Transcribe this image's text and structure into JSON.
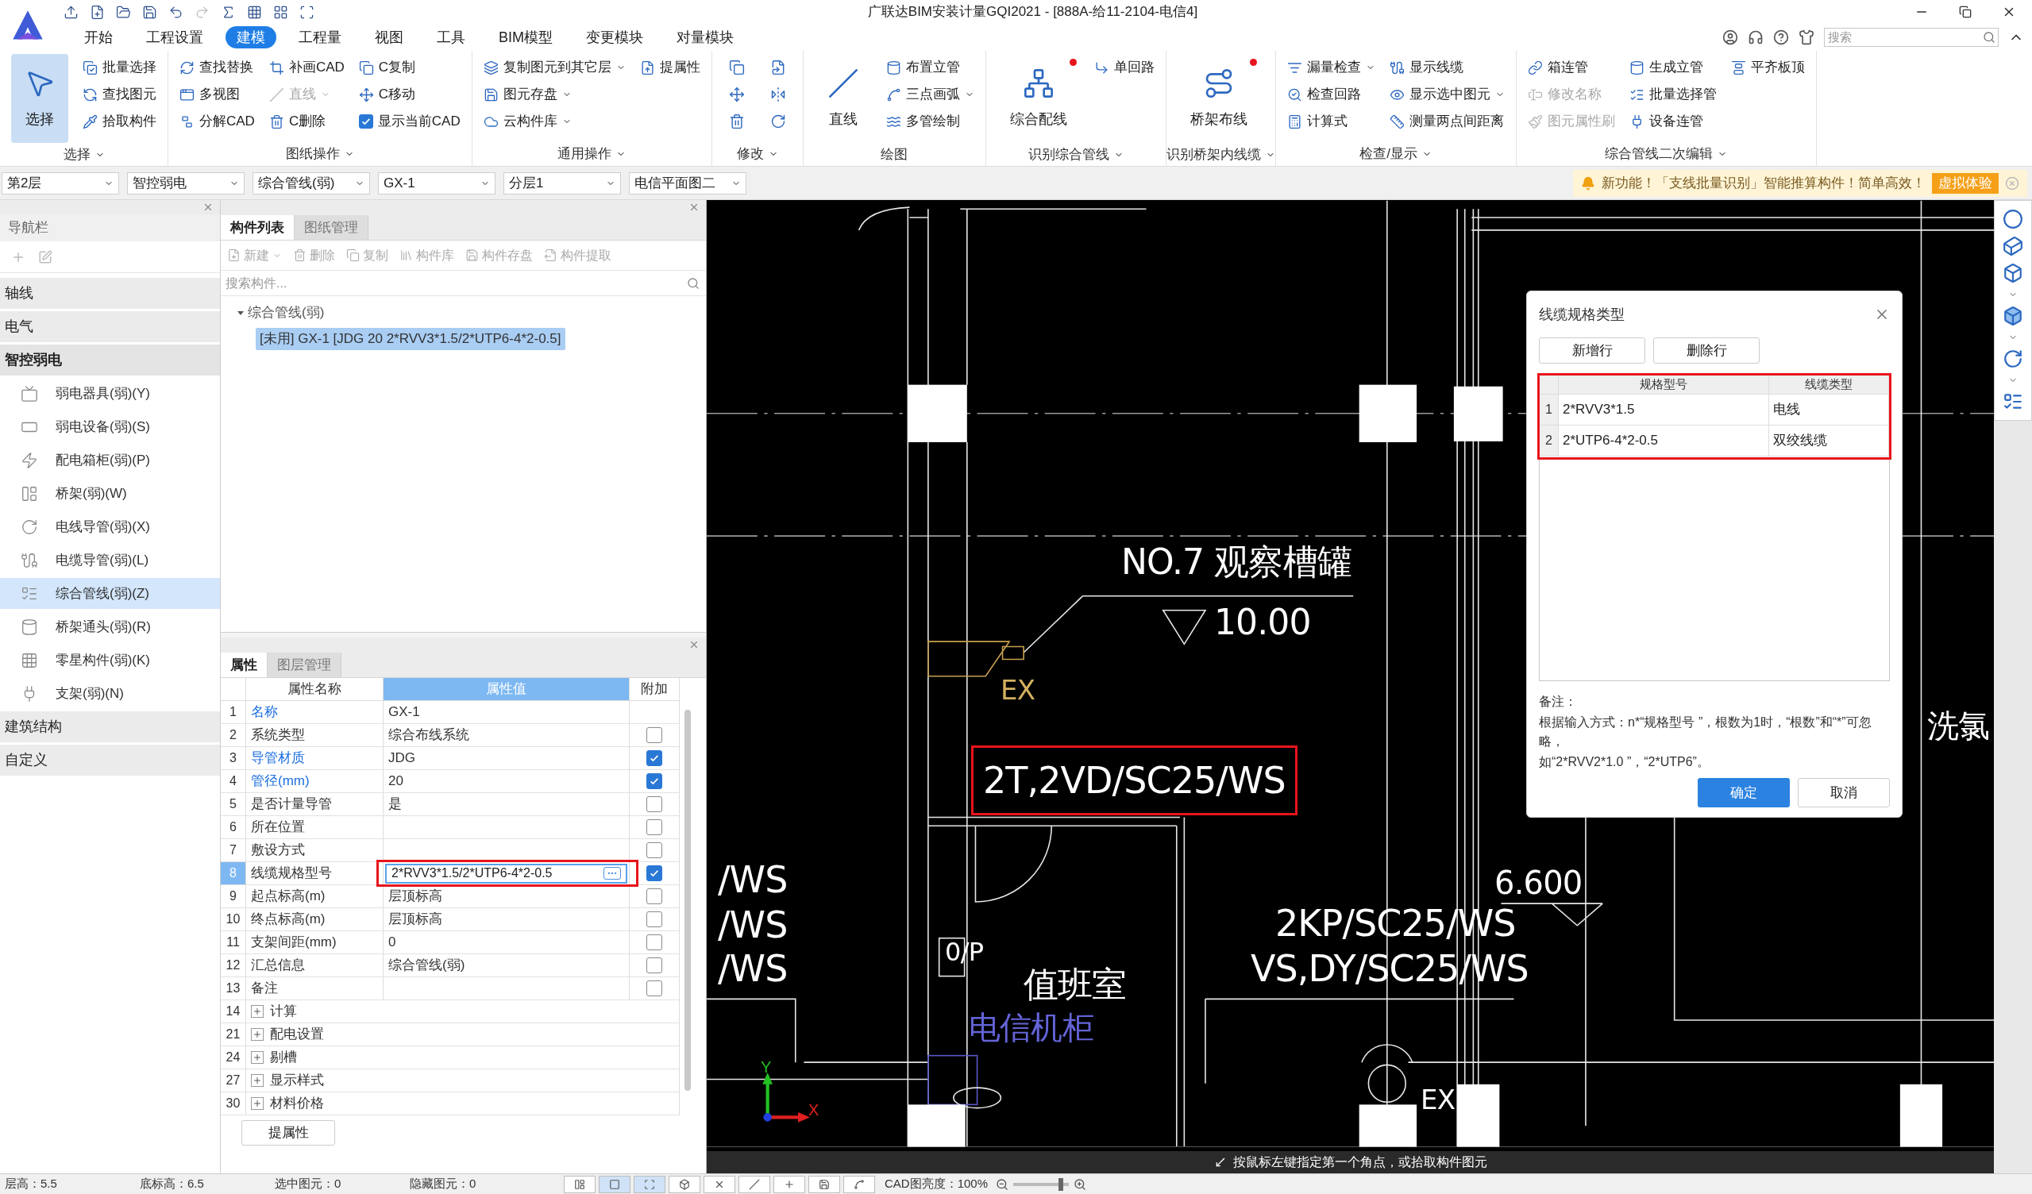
{
  "app": {
    "title": "广联达BIM安装计量GQI2021 - [888A-给11-2104-电信4]",
    "search": {
      "placeholder": "搜索"
    }
  },
  "menu": [
    {
      "label": "开始",
      "selected": false
    },
    {
      "label": "工程设置",
      "selected": false
    },
    {
      "label": "建模",
      "selected": true
    },
    {
      "label": "工程量",
      "selected": false
    },
    {
      "label": "视图",
      "selected": false
    },
    {
      "label": "工具",
      "selected": false
    },
    {
      "label": "BIM模型",
      "selected": false
    },
    {
      "label": "变更模块",
      "selected": false
    },
    {
      "label": "对量模块",
      "selected": false
    }
  ],
  "ribbon": [
    {
      "label": "选择",
      "dropdown": true,
      "columns": [
        [
          {
            "kind": "big",
            "label": "选择",
            "active": true,
            "badge": false
          }
        ],
        [
          {
            "kind": "small",
            "label": "批量选择",
            "disabled": false
          },
          {
            "kind": "small",
            "label": "查找图元",
            "disabled": false
          },
          {
            "kind": "small",
            "label": "拾取构件",
            "disabled": false
          }
        ]
      ]
    },
    {
      "label": "图纸操作",
      "dropdown": true,
      "columns": [
        [
          {
            "kind": "small",
            "label": "查找替换",
            "disabled": false
          },
          {
            "kind": "small",
            "label": "多视图",
            "disabled": false
          },
          {
            "kind": "small",
            "label": "分解CAD",
            "disabled": false
          }
        ],
        [
          {
            "kind": "small",
            "label": "补画CAD",
            "disabled": false
          },
          {
            "kind": "small",
            "label": "直线",
            "disabled": true,
            "dropdown": true
          },
          {
            "kind": "small",
            "label": "C删除",
            "disabled": false
          }
        ],
        [
          {
            "kind": "small",
            "label": "C复制",
            "disabled": false
          },
          {
            "kind": "small",
            "label": "C移动",
            "disabled": false
          },
          {
            "kind": "check",
            "label": "显示当前CAD",
            "checked": true
          }
        ]
      ]
    },
    {
      "label": "通用操作",
      "dropdown": true,
      "columns": [
        [
          {
            "kind": "small",
            "label": "复制图元到其它层",
            "disabled": false,
            "dropdown": true
          },
          {
            "kind": "small",
            "label": "图元存盘",
            "disabled": false,
            "dropdown": true
          },
          {
            "kind": "small",
            "label": "云构件库",
            "disabled": false,
            "dropdown": true
          }
        ],
        [
          {
            "kind": "small",
            "label": "提属性",
            "disabled": false
          }
        ]
      ]
    },
    {
      "label": "修改",
      "dropdown": true,
      "columns": [
        [
          {
            "kind": "icon",
            "disabled": false
          },
          {
            "kind": "icon",
            "disabled": false
          },
          {
            "kind": "icon",
            "disabled": false
          }
        ],
        [
          {
            "kind": "icon",
            "disabled": false
          },
          {
            "kind": "icon",
            "disabled": false
          },
          {
            "kind": "icon",
            "disabled": false
          }
        ]
      ]
    },
    {
      "label": "绘图",
      "dropdown": false,
      "columns": [
        [
          {
            "kind": "big",
            "label": "直线",
            "active": false,
            "badge": false
          }
        ],
        [
          {
            "kind": "small",
            "label": "布置立管",
            "disabled": false
          },
          {
            "kind": "small",
            "label": "三点画弧",
            "disabled": false,
            "dropdown": true
          },
          {
            "kind": "small",
            "label": "多管绘制",
            "disabled": false
          }
        ]
      ]
    },
    {
      "label": "识别综合管线",
      "dropdown": true,
      "columns": [
        [
          {
            "kind": "big",
            "label": "综合配线",
            "active": false,
            "badge": true
          }
        ],
        [
          {
            "kind": "small",
            "label": "单回路",
            "disabled": false
          }
        ]
      ]
    },
    {
      "label": "识别桥架内线缆",
      "dropdown": true,
      "columns": [
        [
          {
            "kind": "big",
            "label": "桥架布线",
            "active": false,
            "badge": true
          }
        ]
      ]
    },
    {
      "label": "检查/显示",
      "dropdown": true,
      "columns": [
        [
          {
            "kind": "small",
            "label": "漏量检查",
            "disabled": false,
            "dropdown": true
          },
          {
            "kind": "small",
            "label": "检查回路",
            "disabled": false
          },
          {
            "kind": "small",
            "label": "计算式",
            "disabled": false
          }
        ],
        [
          {
            "kind": "small",
            "label": "显示线缆",
            "disabled": false
          },
          {
            "kind": "small",
            "label": "显示选中图元",
            "disabled": false,
            "dropdown": true
          },
          {
            "kind": "small",
            "label": "测量两点间距离",
            "disabled": false
          }
        ]
      ]
    },
    {
      "label": "综合管线二次编辑",
      "dropdown": true,
      "columns": [
        [
          {
            "kind": "small",
            "label": "箱连管",
            "disabled": false
          },
          {
            "kind": "small",
            "label": "修改名称",
            "disabled": true
          },
          {
            "kind": "small",
            "label": "图元属性刷",
            "disabled": true
          }
        ],
        [
          {
            "kind": "small",
            "label": "生成立管",
            "disabled": false
          },
          {
            "kind": "small",
            "label": "批量选择管",
            "disabled": false
          },
          {
            "kind": "small",
            "label": "设备连管",
            "disabled": false
          }
        ],
        [
          {
            "kind": "small",
            "label": "平齐板顶",
            "disabled": false
          }
        ]
      ]
    }
  ],
  "selectors": [
    "第2层",
    "智控弱电",
    "综合管线(弱)",
    "GX-1",
    "分层1",
    "电信平面图二"
  ],
  "notice": {
    "text": "新功能！「支线批量识别」智能推算构件！简单高效！",
    "button": "虚拟体验"
  },
  "navigator": {
    "title": "导航栏",
    "categories": [
      {
        "label": "轴线",
        "expanded": false
      },
      {
        "label": "电气",
        "expanded": false
      },
      {
        "label": "智控弱电",
        "expanded": true,
        "children": [
          {
            "label": "弱电器具(弱)(Y)",
            "selected": false
          },
          {
            "label": "弱电设备(弱)(S)",
            "selected": false
          },
          {
            "label": "配电箱柜(弱)(P)",
            "selected": false
          },
          {
            "label": "桥架(弱)(W)",
            "selected": false
          },
          {
            "label": "电线导管(弱)(X)",
            "selected": false
          },
          {
            "label": "电缆导管(弱)(L)",
            "selected": false
          },
          {
            "label": "综合管线(弱)(Z)",
            "selected": true
          },
          {
            "label": "桥架通头(弱)(R)",
            "selected": false
          },
          {
            "label": "零星构件(弱)(K)",
            "selected": false
          },
          {
            "label": "支架(弱)(N)",
            "selected": false
          }
        ]
      },
      {
        "label": "建筑结构",
        "expanded": false
      },
      {
        "label": "自定义",
        "expanded": false
      }
    ]
  },
  "component_panel": {
    "tabs": [
      {
        "label": "构件列表",
        "selected": true
      },
      {
        "label": "图纸管理",
        "selected": false
      }
    ],
    "toolbar": [
      {
        "label": "新建",
        "disabled": true,
        "dropdown": true
      },
      {
        "label": "删除",
        "disabled": true
      },
      {
        "label": "复制",
        "disabled": true
      },
      {
        "label": "构件库",
        "disabled": true
      },
      {
        "label": "构件存盘",
        "disabled": true
      },
      {
        "label": "构件提取",
        "disabled": true
      }
    ],
    "search": {
      "placeholder": "搜索构件..."
    },
    "tree": [
      {
        "label": "综合管线(弱)",
        "expanded": true,
        "children": [
          {
            "label": "[未用] GX-1 [JDG 20 2*RVV3*1.5/2*UTP6-4*2-0.5]",
            "selected": true
          }
        ]
      }
    ]
  },
  "properties": {
    "tabs": [
      {
        "label": "属性",
        "selected": true
      },
      {
        "label": "图层管理",
        "selected": false
      }
    ],
    "columns": [
      "属性名称",
      "属性值",
      "附加"
    ],
    "rows": [
      {
        "kind": "plain",
        "index": "1",
        "name": "名称",
        "value": "GX-1",
        "link": true,
        "selected": false,
        "highlighted": false
      },
      {
        "kind": "check",
        "index": "2",
        "name": "系统类型",
        "value": "综合布线系统",
        "link": false,
        "checked": false,
        "selected": false,
        "highlighted": false
      },
      {
        "kind": "check",
        "index": "3",
        "name": "导管材质",
        "value": "JDG",
        "link": true,
        "checked": true,
        "selected": false,
        "highlighted": false
      },
      {
        "kind": "check",
        "index": "4",
        "name": "管径(mm)",
        "value": "20",
        "link": true,
        "checked": true,
        "selected": false,
        "highlighted": false
      },
      {
        "kind": "check",
        "index": "5",
        "name": "是否计量导管",
        "value": "是",
        "link": false,
        "checked": false,
        "selected": false,
        "highlighted": false
      },
      {
        "kind": "check",
        "index": "6",
        "name": "所在位置",
        "link": false,
        "checked": false,
        "selected": false,
        "highlighted": false
      },
      {
        "kind": "check",
        "index": "7",
        "name": "敷设方式",
        "link": false,
        "checked": false,
        "selected": false,
        "highlighted": false
      },
      {
        "kind": "check",
        "index": "8",
        "name": "线缆规格型号",
        "value": "2*RVV3*1.5/2*UTP6-4*2-0.5",
        "link": false,
        "checked": true,
        "selected": true,
        "highlighted": true
      },
      {
        "kind": "check",
        "index": "9",
        "name": "起点标高(m)",
        "value": "层顶标高",
        "link": false,
        "checked": false,
        "selected": false,
        "highlighted": false
      },
      {
        "kind": "check",
        "index": "10",
        "name": "终点标高(m)",
        "value": "层顶标高",
        "link": false,
        "checked": false,
        "selected": false,
        "highlighted": false
      },
      {
        "kind": "check",
        "index": "11",
        "name": "支架间距(mm)",
        "value": "0",
        "link": false,
        "checked": false,
        "selected": false,
        "highlighted": false
      },
      {
        "kind": "check",
        "index": "12",
        "name": "汇总信息",
        "value": "综合管线(弱)",
        "link": false,
        "checked": false,
        "selected": false,
        "highlighted": false
      },
      {
        "kind": "check",
        "index": "13",
        "name": "备注",
        "link": false,
        "checked": false,
        "selected": false,
        "highlighted": false
      },
      {
        "kind": "group",
        "index": "14",
        "name": "计算",
        "expanded": false,
        "selected": false,
        "highlighted": false
      },
      {
        "kind": "group",
        "index": "21",
        "name": "配电设置",
        "expanded": false,
        "selected": false,
        "highlighted": false
      },
      {
        "kind": "group",
        "index": "24",
        "name": "剔槽",
        "expanded": false,
        "selected": false,
        "highlighted": false
      },
      {
        "kind": "group",
        "index": "27",
        "name": "显示样式",
        "expanded": false,
        "selected": false,
        "highlighted": false
      },
      {
        "kind": "group",
        "index": "30",
        "name": "材料价格",
        "expanded": false,
        "selected": false,
        "highlighted": false
      }
    ],
    "button": "提属性"
  },
  "canvas": {
    "labels": [
      {
        "text": "NO.7 观察槽罐",
        "color": "#ffffff",
        "highlighted": false
      },
      {
        "text": "10.00",
        "color": "#ffffff",
        "highlighted": false
      },
      {
        "text": "EX",
        "color": "#d4b060",
        "highlighted": false
      },
      {
        "text": "2T,2VD/SC25/WS",
        "color": "#ffffff",
        "highlighted": true
      },
      {
        "text": "/WS",
        "color": "#ffffff",
        "highlighted": false
      },
      {
        "text": "/WS",
        "color": "#ffffff",
        "highlighted": false
      },
      {
        "text": "/WS",
        "color": "#ffffff",
        "highlighted": false
      },
      {
        "text": "6.600",
        "color": "#ffffff",
        "highlighted": false
      },
      {
        "text": "2KP/SC25/WS",
        "color": "#ffffff",
        "highlighted": false
      },
      {
        "text": "VS,DY/SC25/WS",
        "color": "#ffffff",
        "highlighted": false
      },
      {
        "text": "0/P",
        "color": "#ffffff",
        "highlighted": false
      },
      {
        "text": "值班室",
        "color": "#ffffff",
        "highlighted": false
      },
      {
        "text": "电信机柜",
        "color": "#6464d8",
        "highlighted": false
      },
      {
        "text": "EX",
        "color": "#ffffff",
        "highlighted": false
      },
      {
        "text": "洗氯",
        "color": "#ffffff",
        "highlighted": false
      }
    ],
    "axes": {
      "x": "X",
      "y": "Y"
    },
    "hint": "按鼠标左键指定第一个角点，或拾取构件图元"
  },
  "dialog": {
    "title": "线缆规格类型",
    "buttons": [
      "新增行",
      "删除行"
    ],
    "table": {
      "highlighted": true,
      "columns": [
        "规格型号",
        "线缆类型"
      ],
      "rows": [
        {
          "index": "1",
          "cells": [
            "2*RVV3*1.5",
            "电线"
          ]
        },
        {
          "index": "2",
          "cells": [
            "2*UTP6-4*2-0.5",
            "双绞线缆"
          ]
        }
      ]
    },
    "note": [
      "备注：",
      "根据输入方式：n*“规格型号 ”，根数为1时，“根数”和“*”可忽略，",
      "如“2*RVV2*1.0 ”，“2*UTP6”。"
    ],
    "actions": [
      {
        "label": "确定",
        "kind": "primary"
      },
      {
        "label": "取消",
        "kind": "default"
      }
    ]
  },
  "status_bar": {
    "items": [
      "层高：5.5",
      "底标高：6.5",
      "选中图元：0",
      "隐藏图元：0"
    ],
    "brightness": "CAD图亮度：100%",
    "slider": {
      "level": 0.85
    }
  }
}
